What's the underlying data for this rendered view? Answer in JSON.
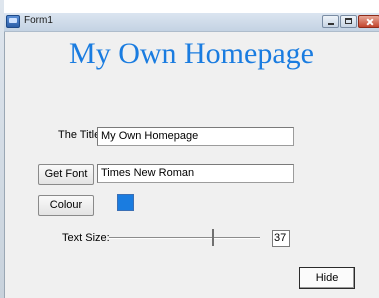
{
  "window": {
    "title": "Form1",
    "heading": "My Own Homepage",
    "heading_color": "#1a7ce0"
  },
  "form": {
    "title_label": "The Title:",
    "title_value": "My Own Homepage",
    "get_font_label": "Get Font",
    "font_value": "Times New Roman",
    "colour_label": "Colour",
    "colour_swatch": "#1a7ce0",
    "text_size_label": "Text Size:",
    "text_size_value": "37",
    "text_size_fraction": 0.68,
    "hide_label": "Hide"
  },
  "icons": {
    "app": "app-window-icon",
    "minimize": "minimize-icon",
    "maximize": "maximize-icon",
    "close": "close-icon"
  }
}
